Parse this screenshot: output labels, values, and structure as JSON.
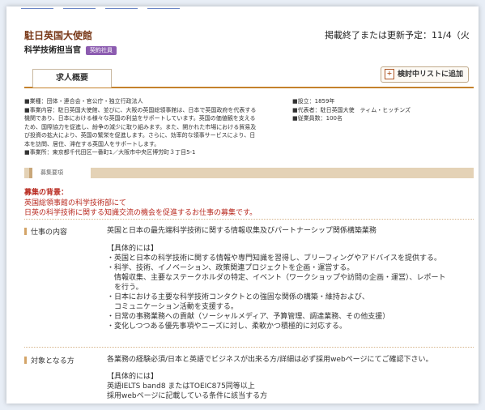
{
  "header": {
    "company": "駐日英国大使館",
    "deadline": "掲載終了または更新予定：11/4（火",
    "job_title": "科学技術担当官",
    "badge": "契約社員"
  },
  "tabs": {
    "active": "求人概要"
  },
  "actions": {
    "add_to_list": "検討中リストに追加"
  },
  "company_info": {
    "left": [
      "■業種：団体・連合会・官公庁・独立行政法人",
      "■事業内容：駐日英国大使館、並びに、大阪の英国総領事館は、日本で英国政府を代表する",
      "機関であり、日本における様々な英国の利益をサポートしています。英国の価値観を支える",
      "ため、国際協力を促進し、紛争の減少に取り組みます。また、開かれた市場における貿易及",
      "び投資の拡大により、英国の繁栄を促進します。さらに、効率的な領事サービスにより、日",
      "本を訪問、居住、滞在する英国人をサポートします。",
      "■事業所：東京都千代田区一番町1／大阪市中央区博労町３丁目5-1"
    ],
    "right": [
      "■設立：1859年",
      "■代表者：駐日英国大使　ティム・ヒッチンズ",
      "■従業員数：100名"
    ]
  },
  "section": {
    "label": "募集要項"
  },
  "background": {
    "title": "募集の背景：",
    "lines": [
      "英国総領事館の科学技術部にて",
      "日英の科学技術に関する知識交流の機会を促進するお仕事の募集です。"
    ]
  },
  "job_content": {
    "label": "仕事の内容",
    "summary": "英国と日本の最先端科学技術に関する情報収集及びパートナーシップ関係構築業務",
    "details": [
      "【具体的には】",
      "・英国と日本の科学技術に関する情報や専門知識を習得し、ブリーフィングやアドバイスを提供する。",
      "・科学、技術、イノベーション、政策関連プロジェクトを企画・運営する。",
      "　情報収集、主要なステークホルダの特定、イベント（ワークショップや訪問の企画・運営）、レポート",
      "　を行う。",
      "・日本における主要な科学技術コンタクトとの強固な関係の構築・維持および、",
      "　コミュニケーション活動を支援する。",
      "・日常の事務業務への貢献（ソーシャルメディア、予算管理、調達業務、その他支援）",
      "・変化しつつある優先事項やニーズに対し、柔軟かつ積極的に対応する。"
    ]
  },
  "target": {
    "label": "対象となる方",
    "summary": "各業務の経験必須/日本と英語でビジネスが出来る方/詳細は必ず採用webページにてご確認下さい。",
    "details": [
      "【具体的には】",
      "英語IELTS band8 またはTOEIC875同等以上",
      "採用webページに記載している条件に該当する方"
    ]
  }
}
